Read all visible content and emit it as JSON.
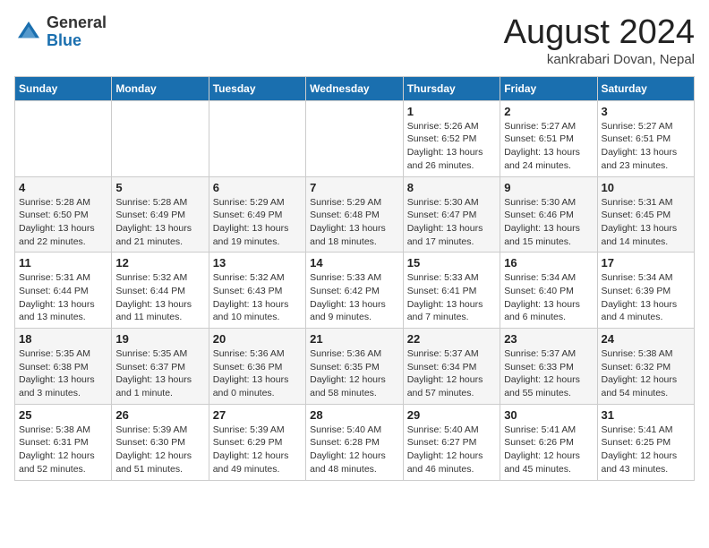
{
  "header": {
    "logo_general": "General",
    "logo_blue": "Blue",
    "month_year": "August 2024",
    "location": "kankrabari Dovan, Nepal"
  },
  "weekdays": [
    "Sunday",
    "Monday",
    "Tuesday",
    "Wednesday",
    "Thursday",
    "Friday",
    "Saturday"
  ],
  "weeks": [
    [
      {
        "day": "",
        "info": ""
      },
      {
        "day": "",
        "info": ""
      },
      {
        "day": "",
        "info": ""
      },
      {
        "day": "",
        "info": ""
      },
      {
        "day": "1",
        "info": "Sunrise: 5:26 AM\nSunset: 6:52 PM\nDaylight: 13 hours\nand 26 minutes."
      },
      {
        "day": "2",
        "info": "Sunrise: 5:27 AM\nSunset: 6:51 PM\nDaylight: 13 hours\nand 24 minutes."
      },
      {
        "day": "3",
        "info": "Sunrise: 5:27 AM\nSunset: 6:51 PM\nDaylight: 13 hours\nand 23 minutes."
      }
    ],
    [
      {
        "day": "4",
        "info": "Sunrise: 5:28 AM\nSunset: 6:50 PM\nDaylight: 13 hours\nand 22 minutes."
      },
      {
        "day": "5",
        "info": "Sunrise: 5:28 AM\nSunset: 6:49 PM\nDaylight: 13 hours\nand 21 minutes."
      },
      {
        "day": "6",
        "info": "Sunrise: 5:29 AM\nSunset: 6:49 PM\nDaylight: 13 hours\nand 19 minutes."
      },
      {
        "day": "7",
        "info": "Sunrise: 5:29 AM\nSunset: 6:48 PM\nDaylight: 13 hours\nand 18 minutes."
      },
      {
        "day": "8",
        "info": "Sunrise: 5:30 AM\nSunset: 6:47 PM\nDaylight: 13 hours\nand 17 minutes."
      },
      {
        "day": "9",
        "info": "Sunrise: 5:30 AM\nSunset: 6:46 PM\nDaylight: 13 hours\nand 15 minutes."
      },
      {
        "day": "10",
        "info": "Sunrise: 5:31 AM\nSunset: 6:45 PM\nDaylight: 13 hours\nand 14 minutes."
      }
    ],
    [
      {
        "day": "11",
        "info": "Sunrise: 5:31 AM\nSunset: 6:44 PM\nDaylight: 13 hours\nand 13 minutes."
      },
      {
        "day": "12",
        "info": "Sunrise: 5:32 AM\nSunset: 6:44 PM\nDaylight: 13 hours\nand 11 minutes."
      },
      {
        "day": "13",
        "info": "Sunrise: 5:32 AM\nSunset: 6:43 PM\nDaylight: 13 hours\nand 10 minutes."
      },
      {
        "day": "14",
        "info": "Sunrise: 5:33 AM\nSunset: 6:42 PM\nDaylight: 13 hours\nand 9 minutes."
      },
      {
        "day": "15",
        "info": "Sunrise: 5:33 AM\nSunset: 6:41 PM\nDaylight: 13 hours\nand 7 minutes."
      },
      {
        "day": "16",
        "info": "Sunrise: 5:34 AM\nSunset: 6:40 PM\nDaylight: 13 hours\nand 6 minutes."
      },
      {
        "day": "17",
        "info": "Sunrise: 5:34 AM\nSunset: 6:39 PM\nDaylight: 13 hours\nand 4 minutes."
      }
    ],
    [
      {
        "day": "18",
        "info": "Sunrise: 5:35 AM\nSunset: 6:38 PM\nDaylight: 13 hours\nand 3 minutes."
      },
      {
        "day": "19",
        "info": "Sunrise: 5:35 AM\nSunset: 6:37 PM\nDaylight: 13 hours\nand 1 minute."
      },
      {
        "day": "20",
        "info": "Sunrise: 5:36 AM\nSunset: 6:36 PM\nDaylight: 13 hours\nand 0 minutes."
      },
      {
        "day": "21",
        "info": "Sunrise: 5:36 AM\nSunset: 6:35 PM\nDaylight: 12 hours\nand 58 minutes."
      },
      {
        "day": "22",
        "info": "Sunrise: 5:37 AM\nSunset: 6:34 PM\nDaylight: 12 hours\nand 57 minutes."
      },
      {
        "day": "23",
        "info": "Sunrise: 5:37 AM\nSunset: 6:33 PM\nDaylight: 12 hours\nand 55 minutes."
      },
      {
        "day": "24",
        "info": "Sunrise: 5:38 AM\nSunset: 6:32 PM\nDaylight: 12 hours\nand 54 minutes."
      }
    ],
    [
      {
        "day": "25",
        "info": "Sunrise: 5:38 AM\nSunset: 6:31 PM\nDaylight: 12 hours\nand 52 minutes."
      },
      {
        "day": "26",
        "info": "Sunrise: 5:39 AM\nSunset: 6:30 PM\nDaylight: 12 hours\nand 51 minutes."
      },
      {
        "day": "27",
        "info": "Sunrise: 5:39 AM\nSunset: 6:29 PM\nDaylight: 12 hours\nand 49 minutes."
      },
      {
        "day": "28",
        "info": "Sunrise: 5:40 AM\nSunset: 6:28 PM\nDaylight: 12 hours\nand 48 minutes."
      },
      {
        "day": "29",
        "info": "Sunrise: 5:40 AM\nSunset: 6:27 PM\nDaylight: 12 hours\nand 46 minutes."
      },
      {
        "day": "30",
        "info": "Sunrise: 5:41 AM\nSunset: 6:26 PM\nDaylight: 12 hours\nand 45 minutes."
      },
      {
        "day": "31",
        "info": "Sunrise: 5:41 AM\nSunset: 6:25 PM\nDaylight: 12 hours\nand 43 minutes."
      }
    ]
  ]
}
